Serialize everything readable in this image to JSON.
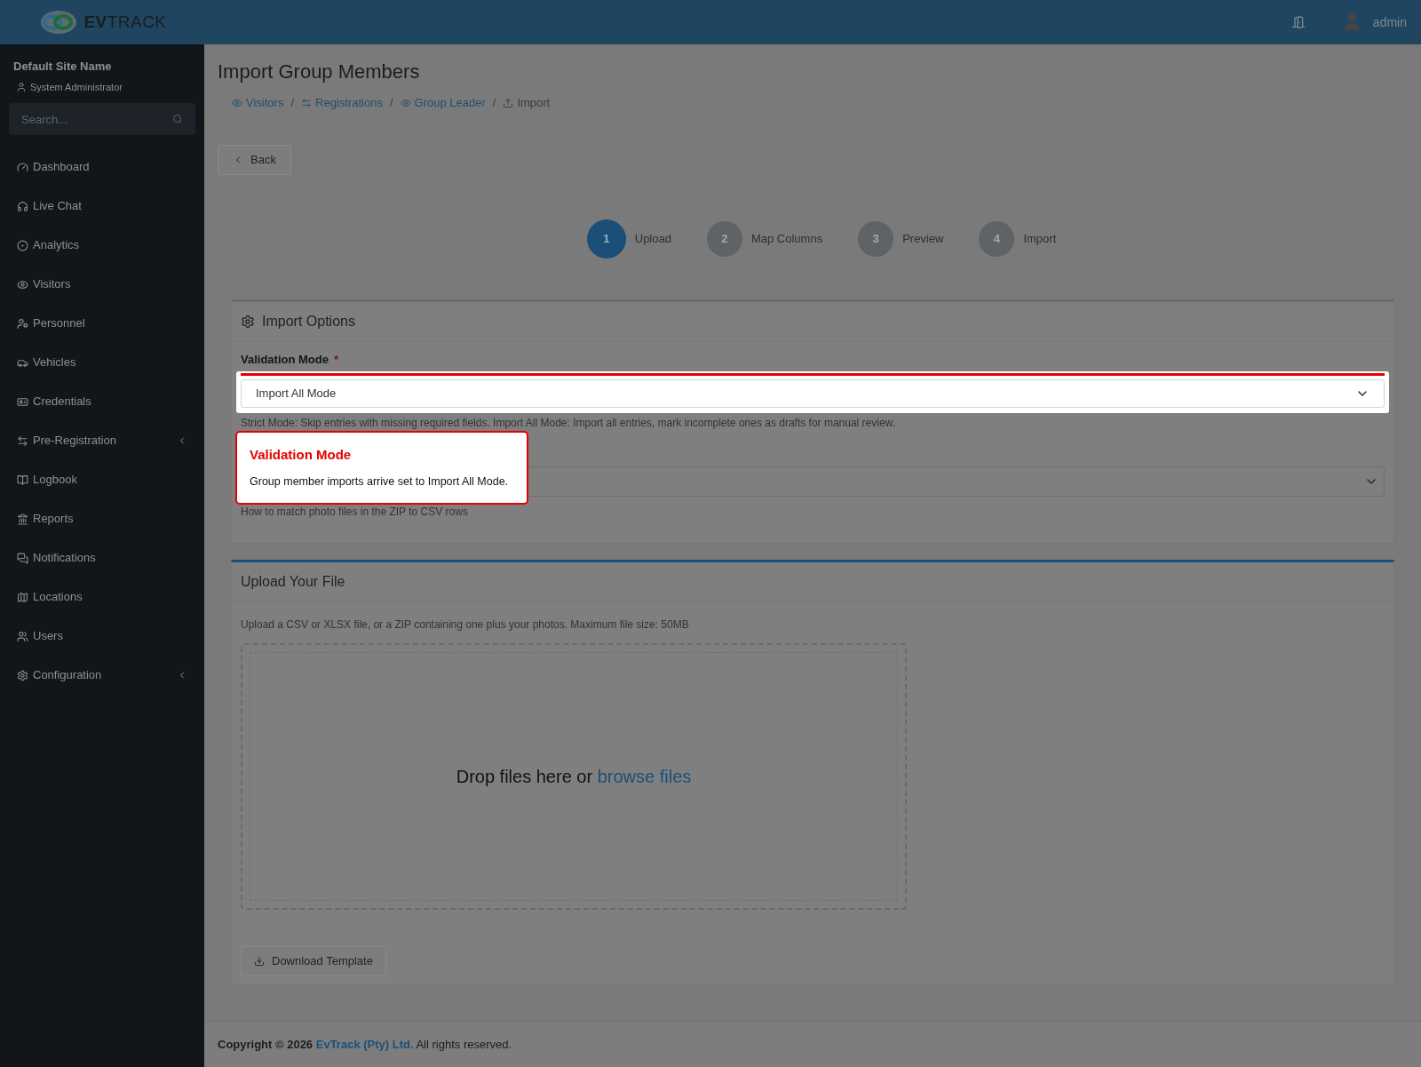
{
  "header": {
    "logo_bold": "EV",
    "logo_light": "TRACK",
    "user": "admin"
  },
  "sidebar": {
    "site_name": "Default Site Name",
    "role": "System Administrator",
    "search": {
      "placeholder": "Search..."
    },
    "items": [
      {
        "label": "Dashboard",
        "kind": "link"
      },
      {
        "label": "Live Chat",
        "kind": "link"
      },
      {
        "label": "Analytics",
        "kind": "link"
      },
      {
        "label": "Visitors",
        "kind": "link"
      },
      {
        "label": "Personnel",
        "kind": "link"
      },
      {
        "label": "Vehicles",
        "kind": "link"
      },
      {
        "label": "Credentials",
        "kind": "link"
      },
      {
        "label": "Pre-Registration",
        "kind": "submenu"
      },
      {
        "label": "Logbook",
        "kind": "link"
      },
      {
        "label": "Reports",
        "kind": "link"
      },
      {
        "label": "Notifications",
        "kind": "link"
      },
      {
        "label": "Locations",
        "kind": "link"
      },
      {
        "label": "Users",
        "kind": "link"
      },
      {
        "label": "Configuration",
        "kind": "submenu"
      }
    ]
  },
  "page": {
    "title": "Import Group Members",
    "breadcrumbs": [
      {
        "label": "Visitors",
        "kind": "link"
      },
      {
        "label": "Registrations",
        "kind": "link"
      },
      {
        "label": "Group Leader",
        "kind": "link"
      },
      {
        "label": "Import",
        "kind": "current"
      }
    ],
    "breadcrumb_separator": "/",
    "back_button": "Back",
    "steps": [
      {
        "number": "1",
        "label": "Upload",
        "selected": true
      },
      {
        "number": "2",
        "label": "Map Columns",
        "selected": false
      },
      {
        "number": "3",
        "label": "Preview",
        "selected": false
      },
      {
        "number": "4",
        "label": "Import",
        "selected": false
      }
    ],
    "import_options": {
      "title": "Import Options",
      "validation_mode": {
        "label": "Validation Mode",
        "required": true,
        "required_mark": "*",
        "value": "Import All Mode",
        "help": "Strict Mode: Skip entries with missing required fields. Import All Mode: Import all entries, mark incomplete ones as drafts for manual review."
      },
      "photo_matching": {
        "help": "How to match photo files in the ZIP to CSV rows"
      }
    },
    "tooltip": {
      "title": "Validation Mode",
      "text": "Group member imports arrive set to Import All Mode."
    },
    "upload": {
      "title": "Upload Your File",
      "description": "Upload a CSV or XLSX file, or a ZIP containing one plus your photos. Maximum file size: 50MB",
      "drop_text": "Drop files here or",
      "browse_link": "browse files",
      "download_button": "Download Template"
    }
  },
  "footer": {
    "copyright": "Copyright © 2026",
    "company": "EvTrack (Pty) Ltd.",
    "rights": "All rights reserved."
  }
}
